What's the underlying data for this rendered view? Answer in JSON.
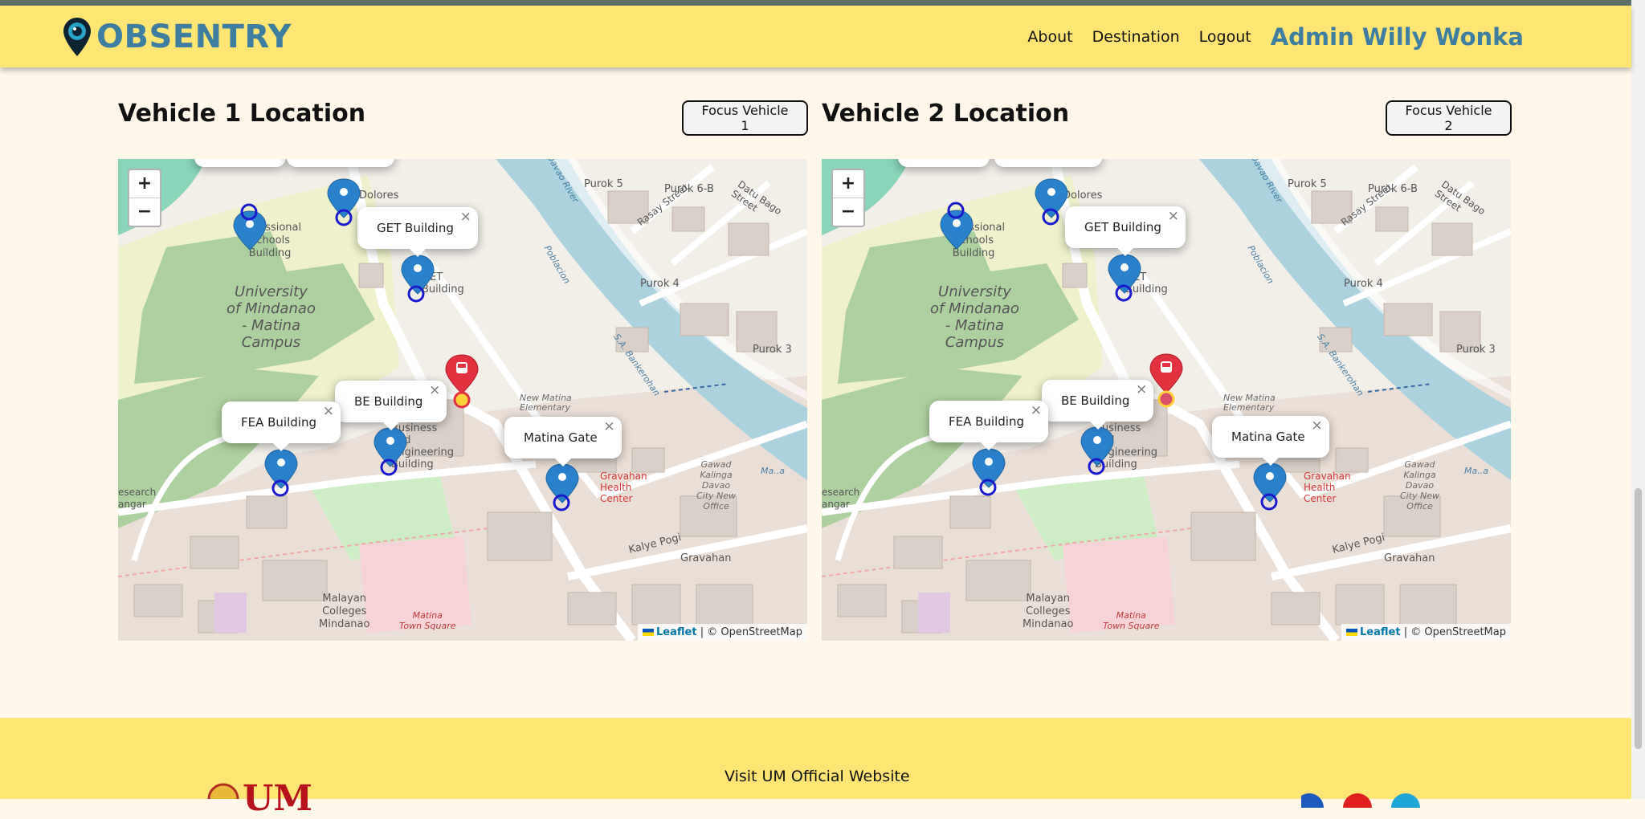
{
  "nav": {
    "brand": "OBSENTRY",
    "links": [
      "About",
      "Destination",
      "Logout"
    ],
    "user": "Admin Willy Wonka"
  },
  "vehicles": [
    {
      "title": "Vehicle 1 Location",
      "focus_label": "Focus Vehicle 1"
    },
    {
      "title": "Vehicle 2 Location",
      "focus_label": "Focus Vehicle 2"
    }
  ],
  "map": {
    "zoom_in": "+",
    "zoom_out": "−",
    "attribution_link": "Leaflet",
    "attribution_text": "| © OpenStreetMap",
    "popups": [
      "GET Building",
      "BE Building",
      "FEA Building",
      "Matina Gate"
    ],
    "popup_close": "×",
    "labels": {
      "campus": [
        "University",
        "of Mindanao",
        "- Matina",
        "Campus"
      ],
      "prof": [
        "Professional",
        "Schools",
        "Building"
      ],
      "malayan": [
        "Malayan",
        "Colleges",
        "Mindanao"
      ],
      "matina_ts": [
        "Matina",
        "Town Square"
      ],
      "gravahan_hc": [
        "Gravahan",
        "Health",
        "Center"
      ],
      "gawad": [
        "Gawad",
        "Kalinga",
        "Davao",
        "City New",
        "Office"
      ],
      "new_matina": [
        "New Matina",
        "Elementary"
      ],
      "business": [
        "Business",
        "and",
        "Engineering",
        "Building"
      ],
      "dolores": "Dolores",
      "get_bldg": [
        "GET",
        "Building"
      ],
      "purok5": "Purok 5",
      "purok6b": "Purok 6-B",
      "purok4": "Purok 4",
      "purok3": "Purok 3",
      "rasay": "Rasay Street",
      "datu": "Datu Bago Street",
      "kalye": "Kalye Pogi",
      "gravahan": "Gravahan",
      "poblacion": "Poblacion",
      "bankerohan": "S.A. Bankerohan",
      "davao_river": "Davao River",
      "research": [
        "esearch",
        "angar"
      ],
      "ma": "Ma..a"
    }
  },
  "footer": {
    "link": "Visit UM Official Website",
    "logo_text": "UM"
  },
  "colors": {
    "accent": "#ffe573",
    "brand": "#3f7ea0",
    "marker": "#2a81cb",
    "vehicle": "#e3323f"
  }
}
